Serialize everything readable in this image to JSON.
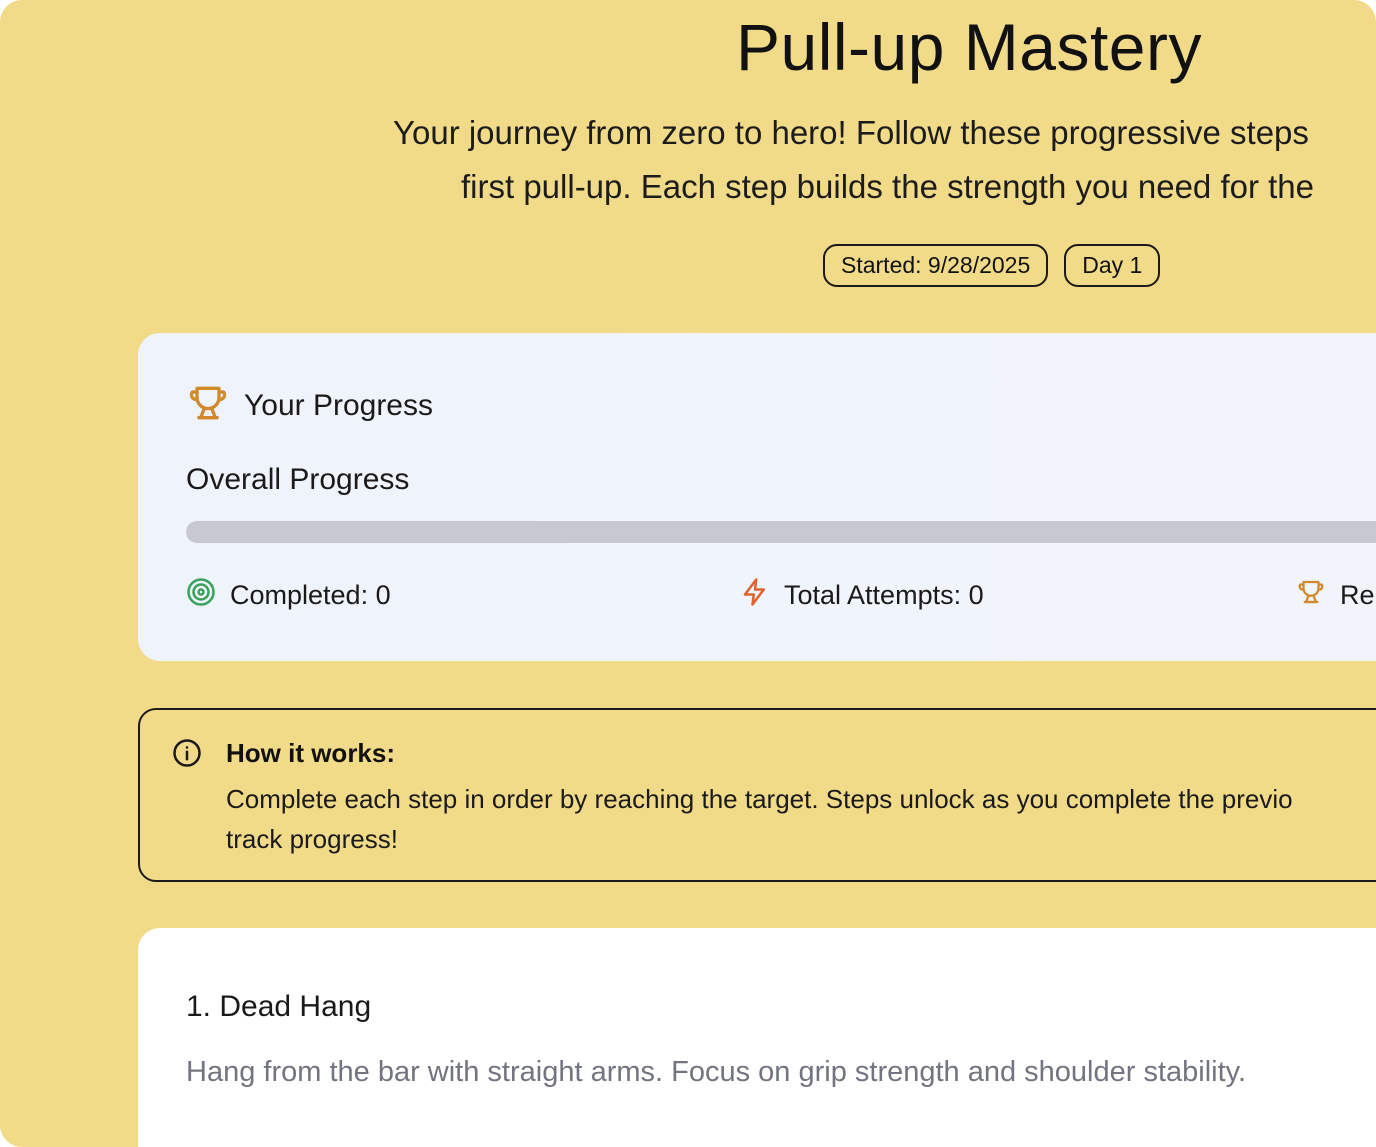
{
  "header": {
    "title": "Pull-up Mastery",
    "subtitle_line1": "Your journey from zero to hero! Follow these progressive steps",
    "subtitle_line2": "first pull-up. Each step builds the strength you need for the",
    "badges": {
      "started": "Started: 9/28/2025",
      "day": "Day 1"
    }
  },
  "progress_card": {
    "title": "Your Progress",
    "overall_label": "Overall Progress",
    "overall_progress_fraction": 0,
    "stats": {
      "completed": "Completed: 0",
      "total_attempts": "Total Attempts: 0",
      "third_partial": "Re"
    },
    "icons": {
      "header": "trophy-icon",
      "completed": "target-icon",
      "attempts": "lightning-icon",
      "third": "trophy-icon"
    },
    "colors": {
      "trophy": "#d1892a",
      "target": "#3aa15a",
      "lightning": "#e0632f"
    }
  },
  "info_box": {
    "icon": "info-icon",
    "title": "How it works:",
    "text_line1": "Complete each step in order by reaching the target. Steps unlock as you complete the previo",
    "text_line2": "track progress!"
  },
  "steps": [
    {
      "title": "1. Dead Hang",
      "description": "Hang from the bar with straight arms. Focus on grip strength and shoulder stability."
    }
  ],
  "theme": {
    "background": "#f1db88"
  }
}
